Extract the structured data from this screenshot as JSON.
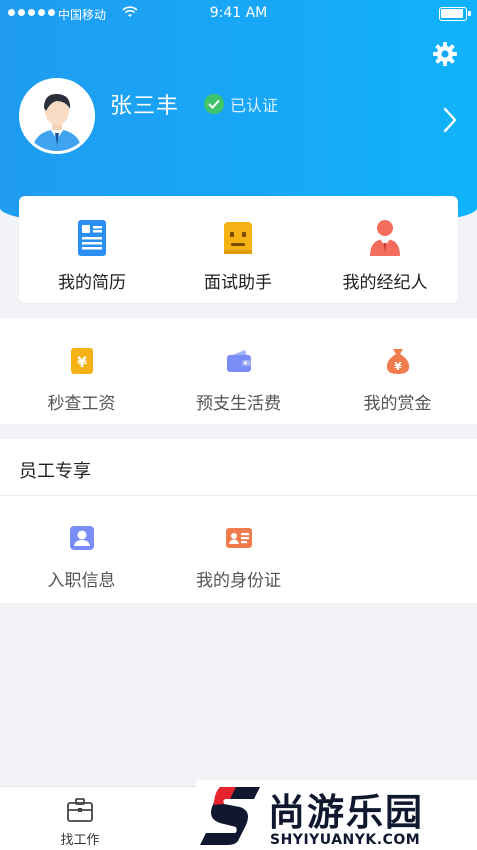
{
  "status_bar": {
    "carrier": "中国移动",
    "time": "9:41 AM"
  },
  "profile": {
    "name": "张三丰",
    "verified_label": "已认证"
  },
  "quick_menu": [
    {
      "label": "我的简历",
      "icon": "resume-icon",
      "color": "#2a8ff0"
    },
    {
      "label": "面试助手",
      "icon": "robot-icon",
      "color": "#f5b214"
    },
    {
      "label": "我的经纪人",
      "icon": "agent-icon",
      "color": "#f36d5c"
    }
  ],
  "finance_menu": [
    {
      "label": "秒查工资",
      "icon": "salary-icon",
      "color": "#f5b214"
    },
    {
      "label": "预支生活费",
      "icon": "wallet-icon",
      "color": "#7a8cf5"
    },
    {
      "label": "我的赏金",
      "icon": "money-bag-icon",
      "color": "#f07b4c"
    }
  ],
  "employee_section": {
    "title": "员工专享",
    "items": [
      {
        "label": "入职信息",
        "icon": "profile-card-icon",
        "color": "#7a8cf5"
      },
      {
        "label": "我的身份证",
        "icon": "id-card-icon",
        "color": "#f07b4c"
      }
    ]
  },
  "tabbar": [
    {
      "label": "找工作",
      "icon": "briefcase-icon"
    }
  ],
  "watermark": {
    "title": "尚游乐园",
    "domain": "SHYIYUANYK.COM"
  }
}
